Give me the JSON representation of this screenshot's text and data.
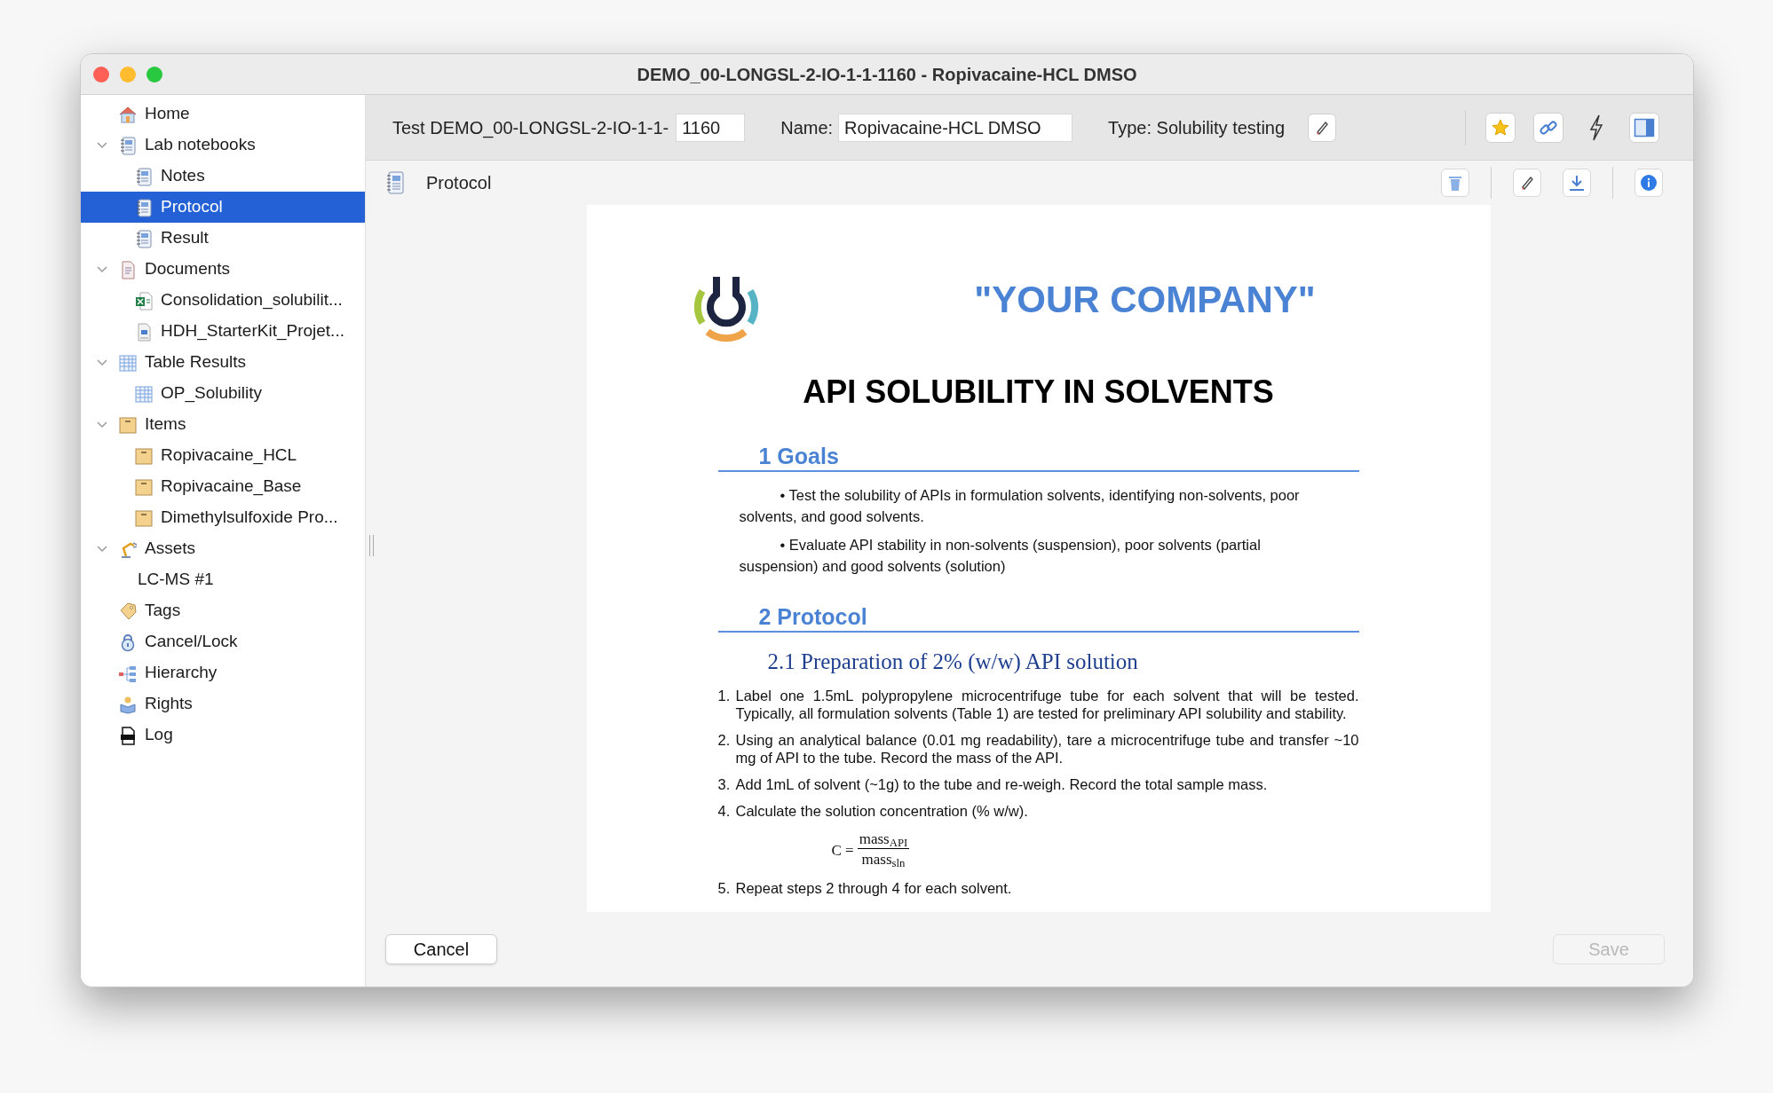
{
  "window": {
    "title": "DEMO_00-LONGSL-2-IO-1-1-1160 - Ropivacaine-HCL DMSO"
  },
  "sidebar": {
    "items": [
      {
        "label": "Home",
        "kind": "home",
        "selected": false
      },
      {
        "label": "Lab notebooks",
        "kind": "notebook",
        "selected": false,
        "expanded": true,
        "children": [
          {
            "label": "Notes",
            "kind": "notebook",
            "selected": false
          },
          {
            "label": "Protocol",
            "kind": "notebook",
            "selected": true
          },
          {
            "label": "Result",
            "kind": "notebook",
            "selected": false
          }
        ]
      },
      {
        "label": "Documents",
        "kind": "document",
        "selected": false,
        "expanded": true,
        "children": [
          {
            "label": "Consolidation_solubilit...",
            "kind": "excel",
            "selected": false
          },
          {
            "label": "HDH_StarterKit_Projet...",
            "kind": "pdf",
            "selected": false
          }
        ]
      },
      {
        "label": "Table Results",
        "kind": "table",
        "selected": false,
        "expanded": true,
        "children": [
          {
            "label": "OP_Solubility",
            "kind": "table",
            "selected": false
          }
        ]
      },
      {
        "label": "Items",
        "kind": "box",
        "selected": false,
        "expanded": true,
        "children": [
          {
            "label": "Ropivacaine_HCL",
            "kind": "box",
            "selected": false
          },
          {
            "label": "Ropivacaine_Base",
            "kind": "box",
            "selected": false
          },
          {
            "label": "Dimethylsulfoxide Pro...",
            "kind": "box",
            "selected": false
          }
        ]
      },
      {
        "label": "Assets",
        "kind": "robot",
        "selected": false,
        "expanded": true,
        "children": [
          {
            "label": "LC-MS #1",
            "kind": "none",
            "selected": false
          }
        ]
      },
      {
        "label": "Tags",
        "kind": "tag",
        "selected": false
      },
      {
        "label": "Cancel/Lock",
        "kind": "lock",
        "selected": false
      },
      {
        "label": "Hierarchy",
        "kind": "hierarchy",
        "selected": false
      },
      {
        "label": "Rights",
        "kind": "rights",
        "selected": false
      },
      {
        "label": "Log",
        "kind": "log",
        "selected": false
      }
    ]
  },
  "header": {
    "test_label": "Test DEMO_00-LONGSL-2-IO-1-1-",
    "test_number": "1160",
    "name_label": "Name:",
    "name_value": "Ropivacaine-HCL DMSO",
    "type_label": "Type: Solubility testing"
  },
  "protocol_bar": {
    "title": "Protocol"
  },
  "document": {
    "company": "\"YOUR COMPANY\"",
    "title": "API SOLUBILITY IN SOLVENTS",
    "goals_heading": "1 Goals",
    "goals": [
      "• Test the solubility of APIs in formulation solvents, identifying non-solvents, poor solvents, and good solvents.",
      "• Evaluate API stability in non-solvents (suspension), poor solvents (partial suspension) and good solvents (solution)"
    ],
    "protocol_heading": "2 Protocol",
    "subheading": "2.1 Preparation of 2% (w/w) API solution",
    "steps": [
      {
        "number": "1.",
        "text": "Label one 1.5mL polypropylene microcentrifuge tube for each solvent that will be tested.  Typically, all formulation solvents (Table 1) are tested for preliminary API solubility and stability."
      },
      {
        "number": "2.",
        "text": "Using an analytical balance (0.01 mg readability), tare a microcentrifuge tube and transfer ~10 mg of API to the tube.  Record the mass of the API."
      },
      {
        "number": "3.",
        "text": "Add 1mL of solvent (~1g) to the tube and re-weigh.  Record the total sample mass."
      },
      {
        "number": "4.",
        "text": "Calculate the solution concentration (% w/w)."
      }
    ],
    "formula": {
      "lhs": "C =",
      "numerator": "mass$_{API}$",
      "denominator": "mass$_{sln}$"
    },
    "steps_after": [
      {
        "number": "5.",
        "text": "Repeat steps 2 through 4 for each solvent."
      }
    ]
  },
  "footer": {
    "cancel": "Cancel",
    "save": "Save",
    "save_disabled": true
  }
}
